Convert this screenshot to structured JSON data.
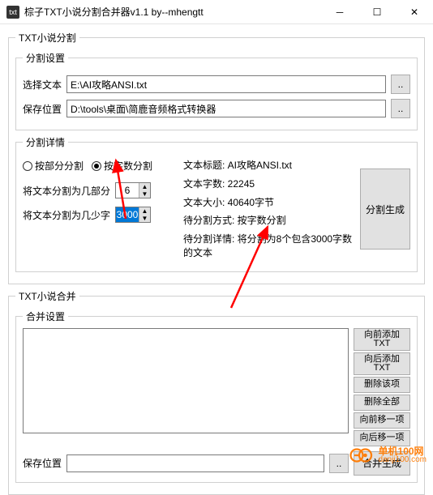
{
  "window": {
    "title": "棕子TXT小说分割合并器v1.1    by--mhengtt",
    "icon_label": "txt"
  },
  "split": {
    "group_label": "TXT小说分割",
    "settings_label": "分割设置",
    "select_text_label": "选择文本",
    "select_text_value": "E:\\AI攻略ANSI.txt",
    "save_loc_label": "保存位置",
    "save_loc_value": "D:\\tools\\桌面\\简鹿音频格式转换器",
    "browse": "..",
    "detail_label": "分割详情",
    "radio_parts": "按部分分割",
    "radio_chars": "按字数分割",
    "split_parts_label": "将文本分割为几部分",
    "split_parts_value": "6",
    "split_chars_label": "将文本分割为几少字",
    "split_chars_value": "3000",
    "info_title": "文本标题:  AI攻略ANSI.txt",
    "info_chars": "文本字数:  22245",
    "info_size": "文本大小:  40640字节",
    "info_mode": "待分割方式:  按字数分割",
    "info_detail": "待分割详情:  将分割为8个包含3000字数的文本",
    "gen_button": "分割生成"
  },
  "merge": {
    "group_label": "TXT小说合并",
    "settings_label": "合并设置",
    "btn_prepend": "向前添加\nTXT",
    "btn_append": "向后添加\nTXT",
    "btn_delete": "删除该项",
    "btn_clear": "删除全部",
    "btn_moveup": "向前移一项",
    "btn_movedown": "向后移一项",
    "save_loc_label": "保存位置",
    "save_loc_value": "",
    "browse": "..",
    "gen_button": "合并生成"
  },
  "watermark": {
    "line1": "单机100网",
    "line2": "danji100.com"
  }
}
